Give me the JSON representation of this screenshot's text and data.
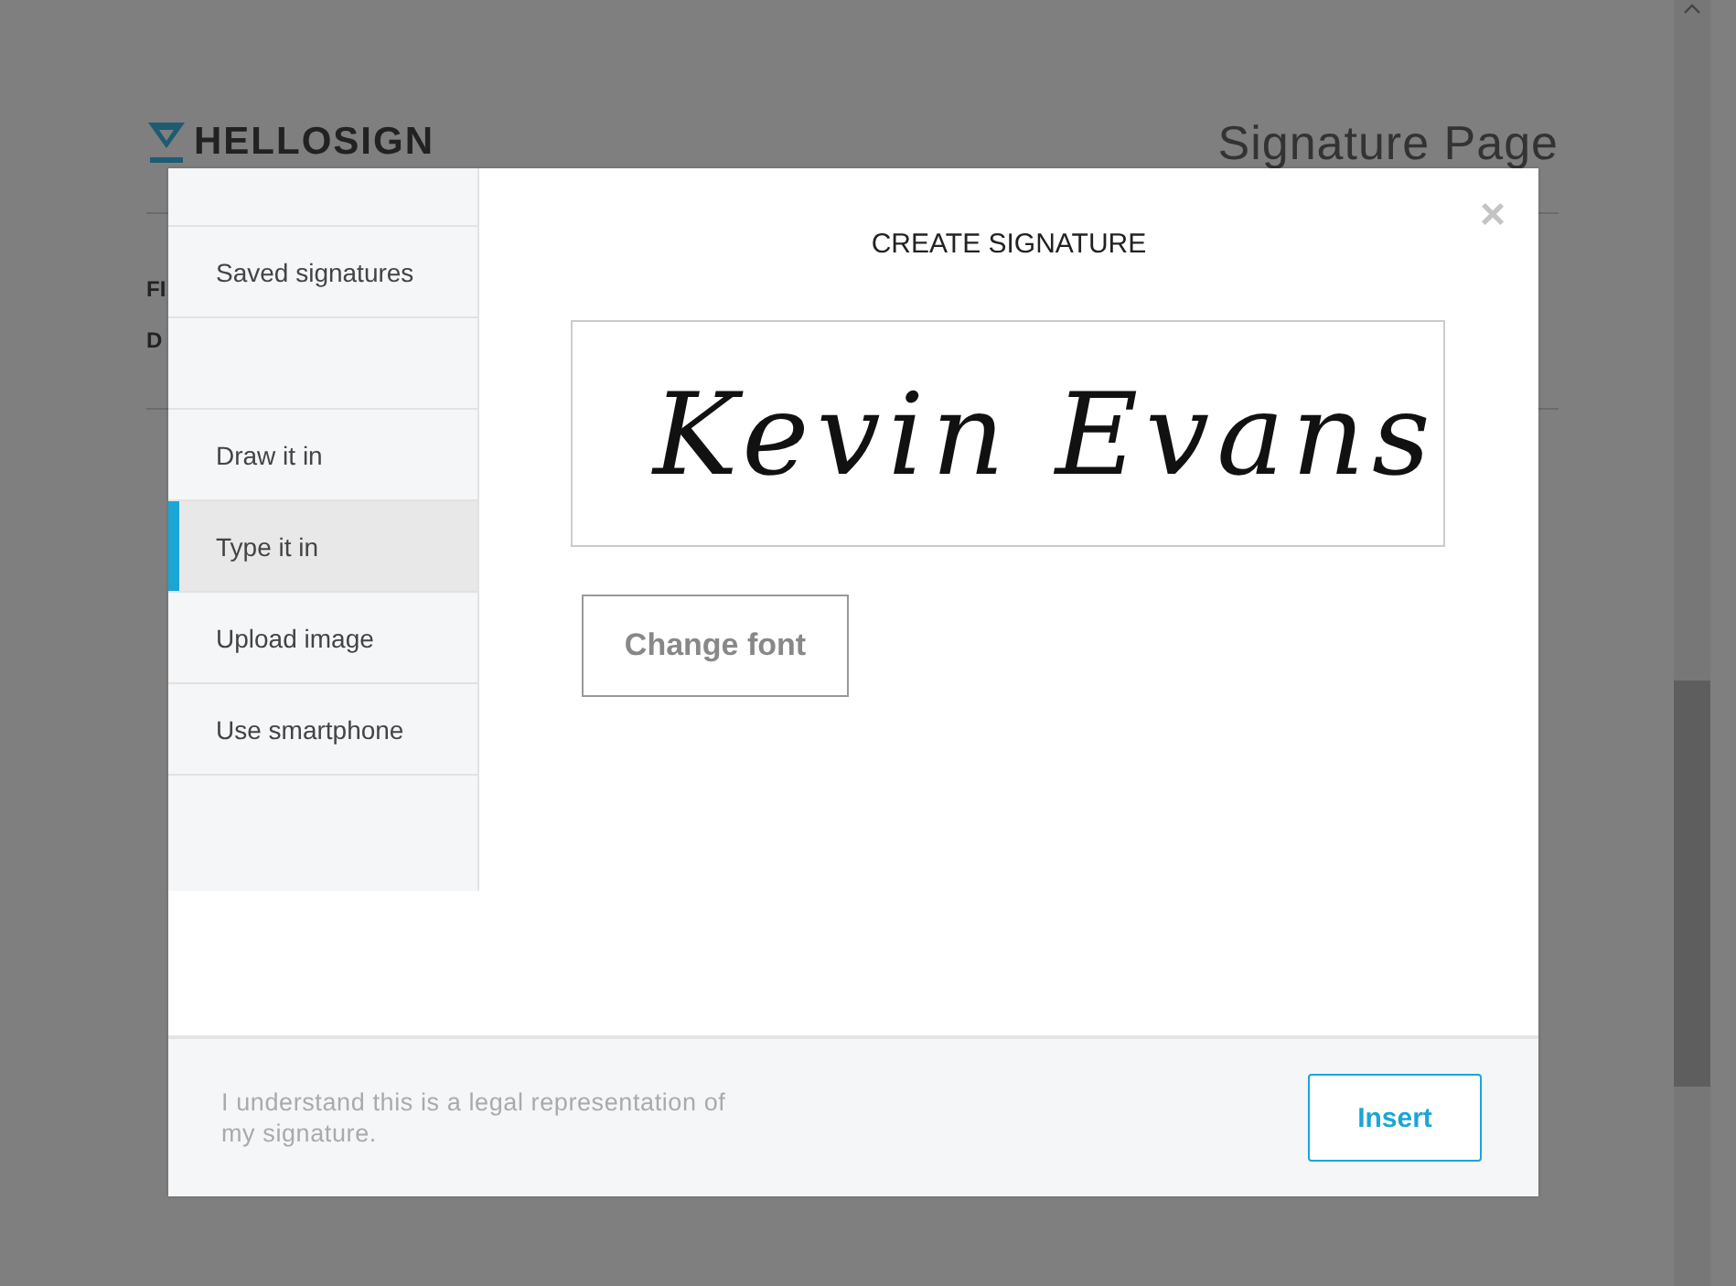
{
  "page": {
    "logo": "HELLOSIGN",
    "title": "Signature Page",
    "field_labels": [
      "FI",
      "D"
    ]
  },
  "modal": {
    "title": "CREATE SIGNATURE",
    "sidebar": [
      {
        "kind": "blank"
      },
      {
        "kind": "option",
        "label": "Saved signatures",
        "selected": false
      },
      {
        "kind": "blank"
      },
      {
        "kind": "option",
        "label": "Draw it in",
        "selected": false
      },
      {
        "kind": "option",
        "label": "Type it in",
        "selected": true
      },
      {
        "kind": "option",
        "label": "Upload image",
        "selected": false
      },
      {
        "kind": "option",
        "label": "Use smartphone",
        "selected": false
      }
    ],
    "signature": "Kevin Evans",
    "change_font": "Change font",
    "close": "×",
    "disclaimer": "I understand this is a legal representation of my signature.",
    "insert": "Insert"
  }
}
